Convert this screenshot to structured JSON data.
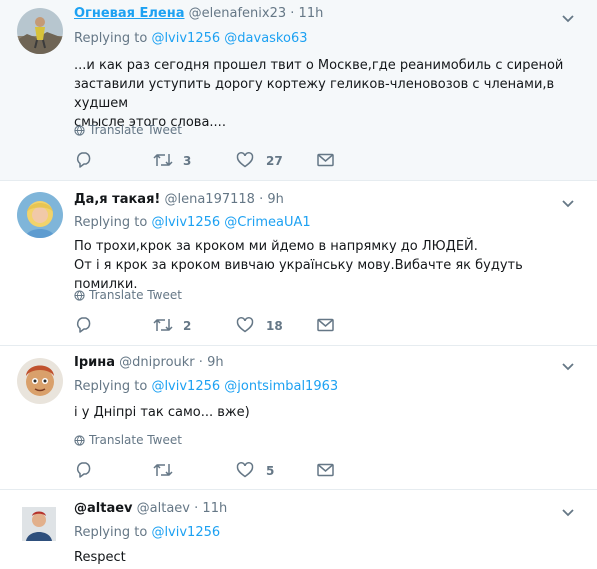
{
  "translate_label": "Translate Tweet",
  "replying_label": "Replying to",
  "tweets": [
    {
      "name": "Огневая Елена",
      "handle": "@elenafenix23",
      "time": "11h",
      "replying_to": [
        "@lviv1256",
        "@davasko63"
      ],
      "text_lines": [
        "...и как раз сегодня прошел твит о Москве,где реанимобиль с сиреной",
        "заставили уступить дорогу кортежу геликов-членовозов с членами,в худшем",
        "смысле этого слова...."
      ],
      "replies": "",
      "retweets": "3",
      "likes": "27"
    },
    {
      "name": "Да,я такая!",
      "handle": "@lena197118",
      "time": "9h",
      "replying_to": [
        "@lviv1256",
        "@CrimeaUA1"
      ],
      "text_lines": [
        "По трохи,крок за кроком ми йдемо в напрямку до ЛЮДЕЙ.",
        "От і я крок за кроком вивчаю українську мову.Вибачте як будуть помилки."
      ],
      "replies": "",
      "retweets": "2",
      "likes": "18"
    },
    {
      "name": "Ірина",
      "handle": "@dniproukr",
      "time": "9h",
      "replying_to": [
        "@lviv1256",
        "@jontsimbal1963"
      ],
      "text_lines": [
        "і у Дніпрі так само... вже)"
      ],
      "replies": "",
      "retweets": "",
      "likes": "5"
    },
    {
      "name": "@altaev",
      "handle": "@altaev",
      "time": "11h",
      "replying_to": [
        "@lviv1256"
      ],
      "text_lines": [
        "Respect"
      ]
    }
  ],
  "colors": {
    "link": "#1da1f2",
    "muted": "#657786",
    "text": "#14171a",
    "highlight_bg": "#f5f8fa",
    "divider": "#e6ecf0"
  }
}
